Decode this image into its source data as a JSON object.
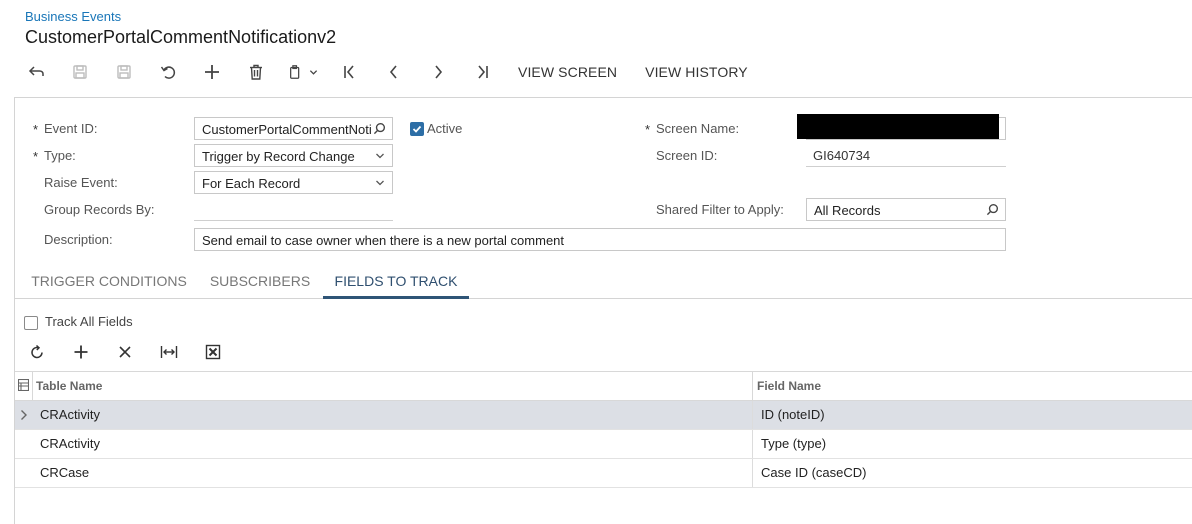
{
  "header": {
    "breadcrumb": "Business Events",
    "title": "CustomerPortalCommentNotificationv2"
  },
  "toolbar": {
    "view_screen": "VIEW SCREEN",
    "view_history": "VIEW HISTORY"
  },
  "form": {
    "event_id": {
      "label": "Event ID:",
      "value": "CustomerPortalCommentNoti"
    },
    "active": {
      "label": "Active",
      "checked": true
    },
    "type": {
      "label": "Type:",
      "value": "Trigger by Record Change"
    },
    "raise_event": {
      "label": "Raise Event:",
      "value": "For Each Record"
    },
    "group_records_by": {
      "label": "Group Records By:",
      "value": ""
    },
    "description": {
      "label": "Description:",
      "value": "Send email to case owner when there is a new portal comment"
    },
    "screen_name": {
      "label": "Screen Name:",
      "value": ""
    },
    "screen_id": {
      "label": "Screen ID:",
      "value": "GI640734"
    },
    "shared_filter": {
      "label": "Shared Filter to Apply:",
      "value": "All Records"
    },
    "required_marker": "*"
  },
  "tabs": [
    {
      "label": "TRIGGER CONDITIONS",
      "active": false
    },
    {
      "label": "SUBSCRIBERS",
      "active": false
    },
    {
      "label": "FIELDS TO TRACK",
      "active": true
    }
  ],
  "fields_to_track": {
    "track_all_label": "Track All Fields",
    "track_all_checked": false,
    "columns": [
      "Table Name",
      "Field Name"
    ],
    "rows": [
      {
        "table": "CRActivity",
        "field": "ID (noteID)",
        "selected": true
      },
      {
        "table": "CRActivity",
        "field": "Type (type)",
        "selected": false
      },
      {
        "table": "CRCase",
        "field": "Case ID (caseCD)",
        "selected": false
      }
    ]
  },
  "icons": {
    "back": "arrow-back-icon",
    "save_close": "save-close-icon",
    "save": "save-icon",
    "undo": "undo-icon",
    "add": "plus-icon",
    "delete": "trash-icon",
    "copy_paste": "clipboard-icon",
    "first": "first-record-icon",
    "prev": "previous-record-icon",
    "next": "next-record-icon",
    "last": "last-record-icon",
    "lookup": "search-icon",
    "dropdown": "chevron-down-icon",
    "refresh": "refresh-icon",
    "remove": "close-icon",
    "fit_columns": "fit-columns-icon",
    "export_excel": "excel-icon"
  },
  "colors": {
    "link": "#1976b8",
    "active_tab": "#2f5577",
    "selected_row": "#dcdfe5",
    "checkbox_checked": "#2d6ea6"
  }
}
